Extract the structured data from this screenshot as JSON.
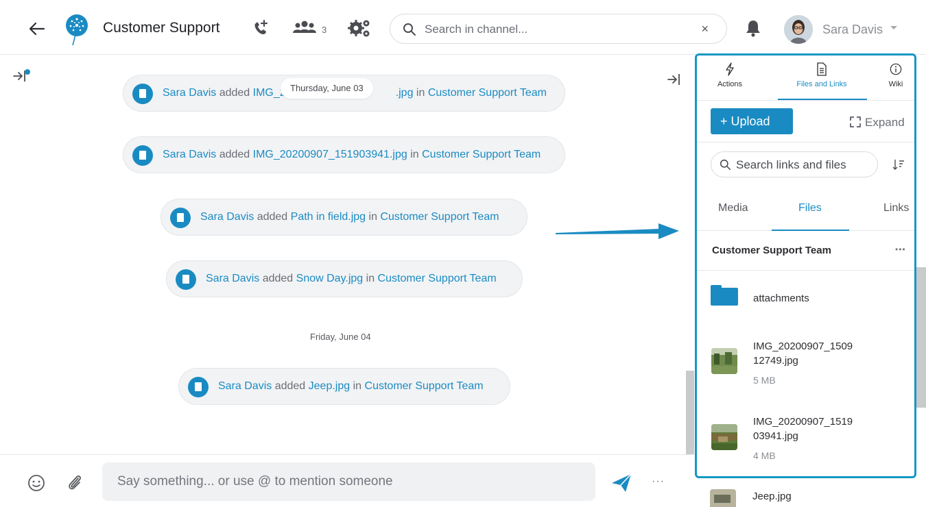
{
  "header": {
    "channel_title": "Customer Support",
    "member_count": "3",
    "search_placeholder": "Search in channel...",
    "clear_label": "×",
    "user_name": "Sara Davis"
  },
  "messages": [
    {
      "user": "Sara Davis",
      "verb": "added",
      "file_start": "IMG_2",
      "file_end": ".jpg",
      "in": "in",
      "team": "Customer Support Team"
    },
    {
      "user": "Sara Davis",
      "verb": "added",
      "file": "IMG_20200907_151903941.jpg",
      "in": "in",
      "team": "Customer Support Team"
    },
    {
      "user": "Sara Davis",
      "verb": "added",
      "file": "Path in field.jpg",
      "in": "in",
      "team": "Customer Support Team"
    },
    {
      "user": "Sara Davis",
      "verb": "added",
      "file": "Snow Day.jpg",
      "in": "in",
      "team": "Customer Support Team"
    },
    {
      "user": "Sara Davis",
      "verb": "added",
      "file": "Jeep.jpg",
      "in": "in",
      "team": "Customer Support Team"
    }
  ],
  "dates": {
    "thursday": "Thursday, June 03",
    "friday": "Friday, June 04"
  },
  "composer": {
    "placeholder": "Say something... or use @ to mention someone",
    "more_label": "···"
  },
  "panel": {
    "tabs": [
      {
        "label": "Actions",
        "icon": "lightning-icon"
      },
      {
        "label": "Files and Links",
        "icon": "document-icon"
      },
      {
        "label": "Wiki",
        "icon": "info-icon"
      }
    ],
    "upload_label": "Upload",
    "upload_prefix": "+",
    "expand_label": "Expand",
    "search_placeholder": "Search links and files",
    "subtabs": [
      "Media",
      "Files",
      "Links"
    ],
    "group_title": "Customer Support Team",
    "group_more": "•••",
    "folder_name": "attachments",
    "files": [
      {
        "name_line1": "IMG_20200907_1509",
        "name_line2": "12749.jpg",
        "size": "5 MB"
      },
      {
        "name_line1": "IMG_20200907_1519",
        "name_line2": "03941.jpg",
        "size": "4 MB"
      }
    ],
    "peek_file": "Jeep.jpg"
  },
  "colors": {
    "accent": "#1a8bc2",
    "panel_border": "#1497c4",
    "bubble_bg": "#f2f3f5"
  }
}
